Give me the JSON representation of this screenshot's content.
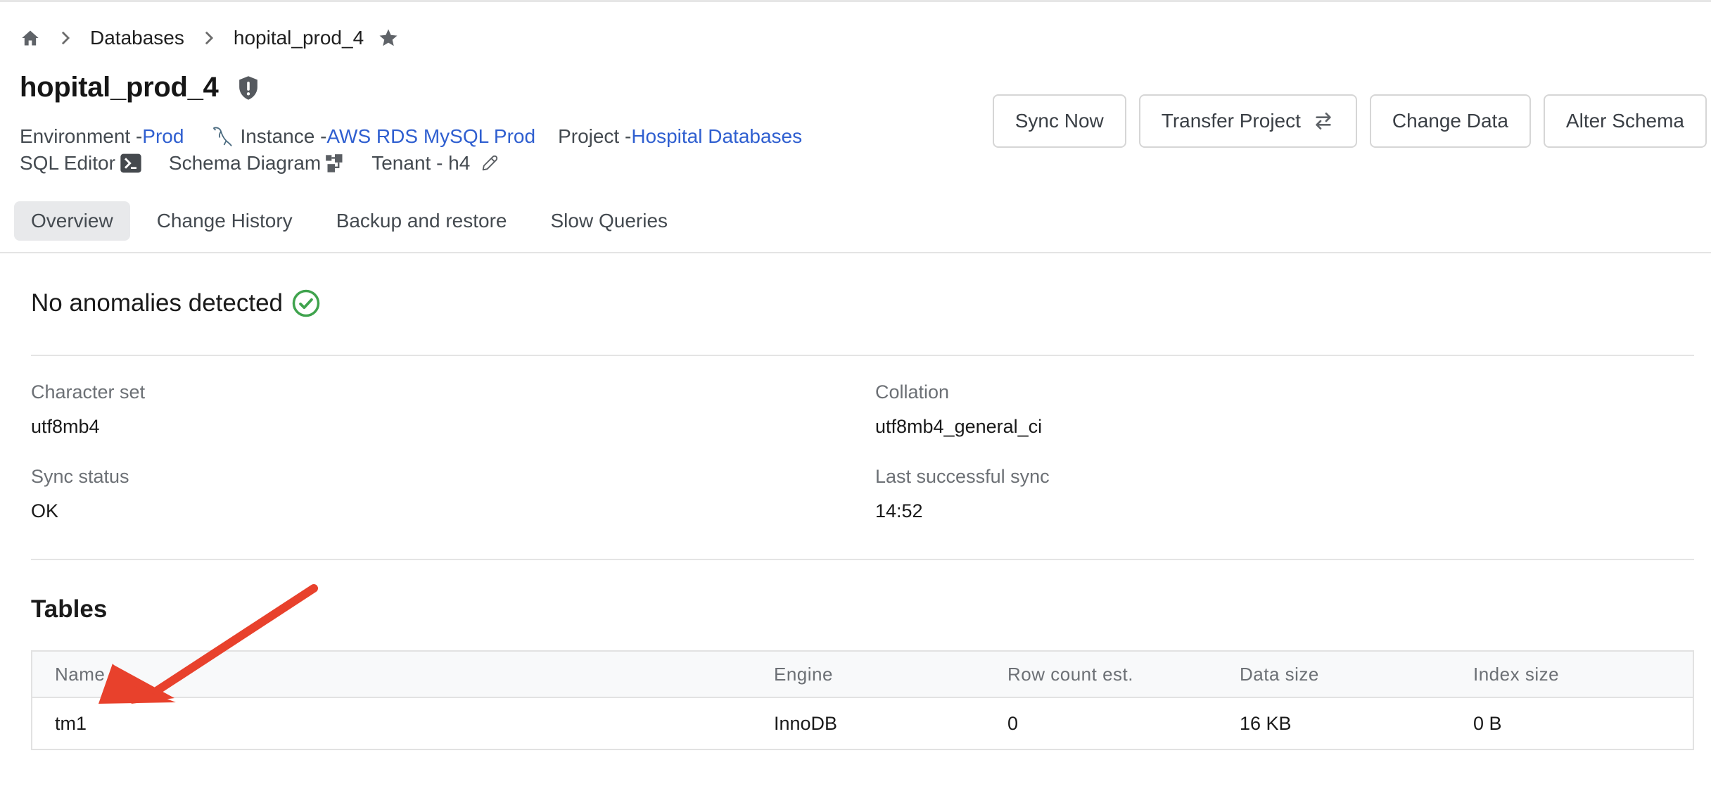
{
  "breadcrumb": {
    "home_icon": "home-icon",
    "items": [
      "Databases",
      "hopital_prod_4"
    ],
    "star_icon": "star-icon"
  },
  "header": {
    "title": "hopital_prod_4",
    "title_icon": "shield-alert-icon",
    "environment_label": "Environment - ",
    "environment_value": "Prod",
    "instance_icon": "mysql-dolphin-icon",
    "instance_label": "Instance - ",
    "instance_value": "AWS RDS MySQL Prod",
    "project_label": "Project - ",
    "project_value": "Hospital Databases",
    "sql_editor_label": "SQL Editor",
    "sql_editor_icon": "terminal-icon",
    "schema_diagram_label": "Schema Diagram",
    "schema_diagram_icon": "diagram-icon",
    "tenant_label": "Tenant - h4",
    "tenant_edit_icon": "pencil-icon",
    "link_color": "#2f5fd0"
  },
  "actions": {
    "sync_now": "Sync Now",
    "transfer_project": "Transfer Project",
    "transfer_icon": "swap-arrows-icon",
    "change_data": "Change Data",
    "alter_schema": "Alter Schema"
  },
  "tabs": [
    {
      "label": "Overview",
      "active": true
    },
    {
      "label": "Change History",
      "active": false
    },
    {
      "label": "Backup and restore",
      "active": false
    },
    {
      "label": "Slow Queries",
      "active": false
    }
  ],
  "overview": {
    "anomaly_text": "No anomalies detected",
    "anomaly_icon": "check-circle-icon",
    "success_color": "#3fa34d",
    "fields": [
      {
        "label": "Character set",
        "value": "utf8mb4"
      },
      {
        "label": "Collation",
        "value": "utf8mb4_general_ci"
      },
      {
        "label": "Sync status",
        "value": "OK"
      },
      {
        "label": "Last successful sync",
        "value": "14:52"
      }
    ]
  },
  "tables": {
    "title": "Tables",
    "columns": [
      "Name",
      "Engine",
      "Row count est.",
      "Data size",
      "Index size"
    ],
    "rows": [
      [
        "tm1",
        "InnoDB",
        "0",
        "16 KB",
        "0 B"
      ]
    ]
  },
  "annotation": {
    "type": "arrow",
    "color": "#e8412c",
    "points_to": "tm1"
  }
}
